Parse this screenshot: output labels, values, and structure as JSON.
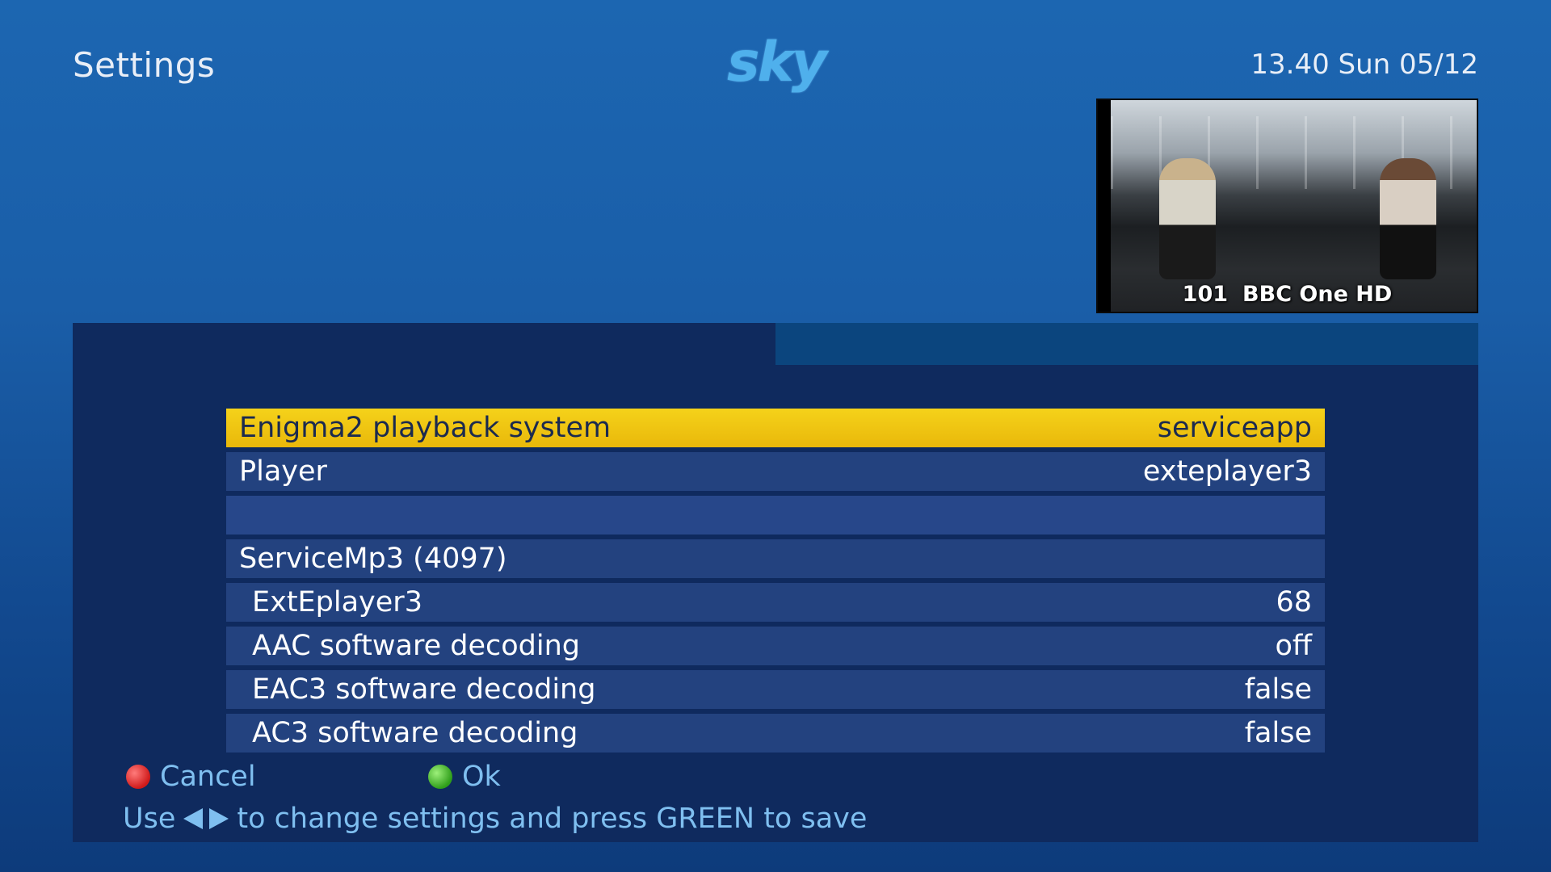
{
  "header": {
    "title": "Settings",
    "logo": "sky",
    "clock": "13.40 Sun 05/12"
  },
  "pip": {
    "channel_number": "101",
    "channel_name": "BBC One HD"
  },
  "settings": {
    "rows": [
      {
        "label": "Enigma2 playback system",
        "value": "serviceapp",
        "selected": true
      },
      {
        "label": "Player",
        "value": "exteplayer3"
      },
      {
        "label": "",
        "value": ""
      },
      {
        "label": "ServiceMp3 (4097)",
        "value": ""
      },
      {
        "label": "ExtEplayer3",
        "value": "68"
      },
      {
        "label": "AAC software decoding",
        "value": "off"
      },
      {
        "label": "EAC3 software decoding",
        "value": "false"
      },
      {
        "label": "AC3 software decoding",
        "value": "false"
      }
    ]
  },
  "footer": {
    "cancel_label": "Cancel",
    "ok_label": "Ok",
    "hint_prefix": "Use",
    "hint_suffix": "to change settings and press GREEN to save"
  },
  "colors": {
    "selected_row": "#f5d21a",
    "row": "#23427f",
    "panel": "#0f2a5e",
    "hint_text": "#7fbff0"
  },
  "icons": {
    "cancel": "red-circle-icon",
    "ok": "green-circle-icon",
    "hint": "left-right-arrows-icon"
  }
}
